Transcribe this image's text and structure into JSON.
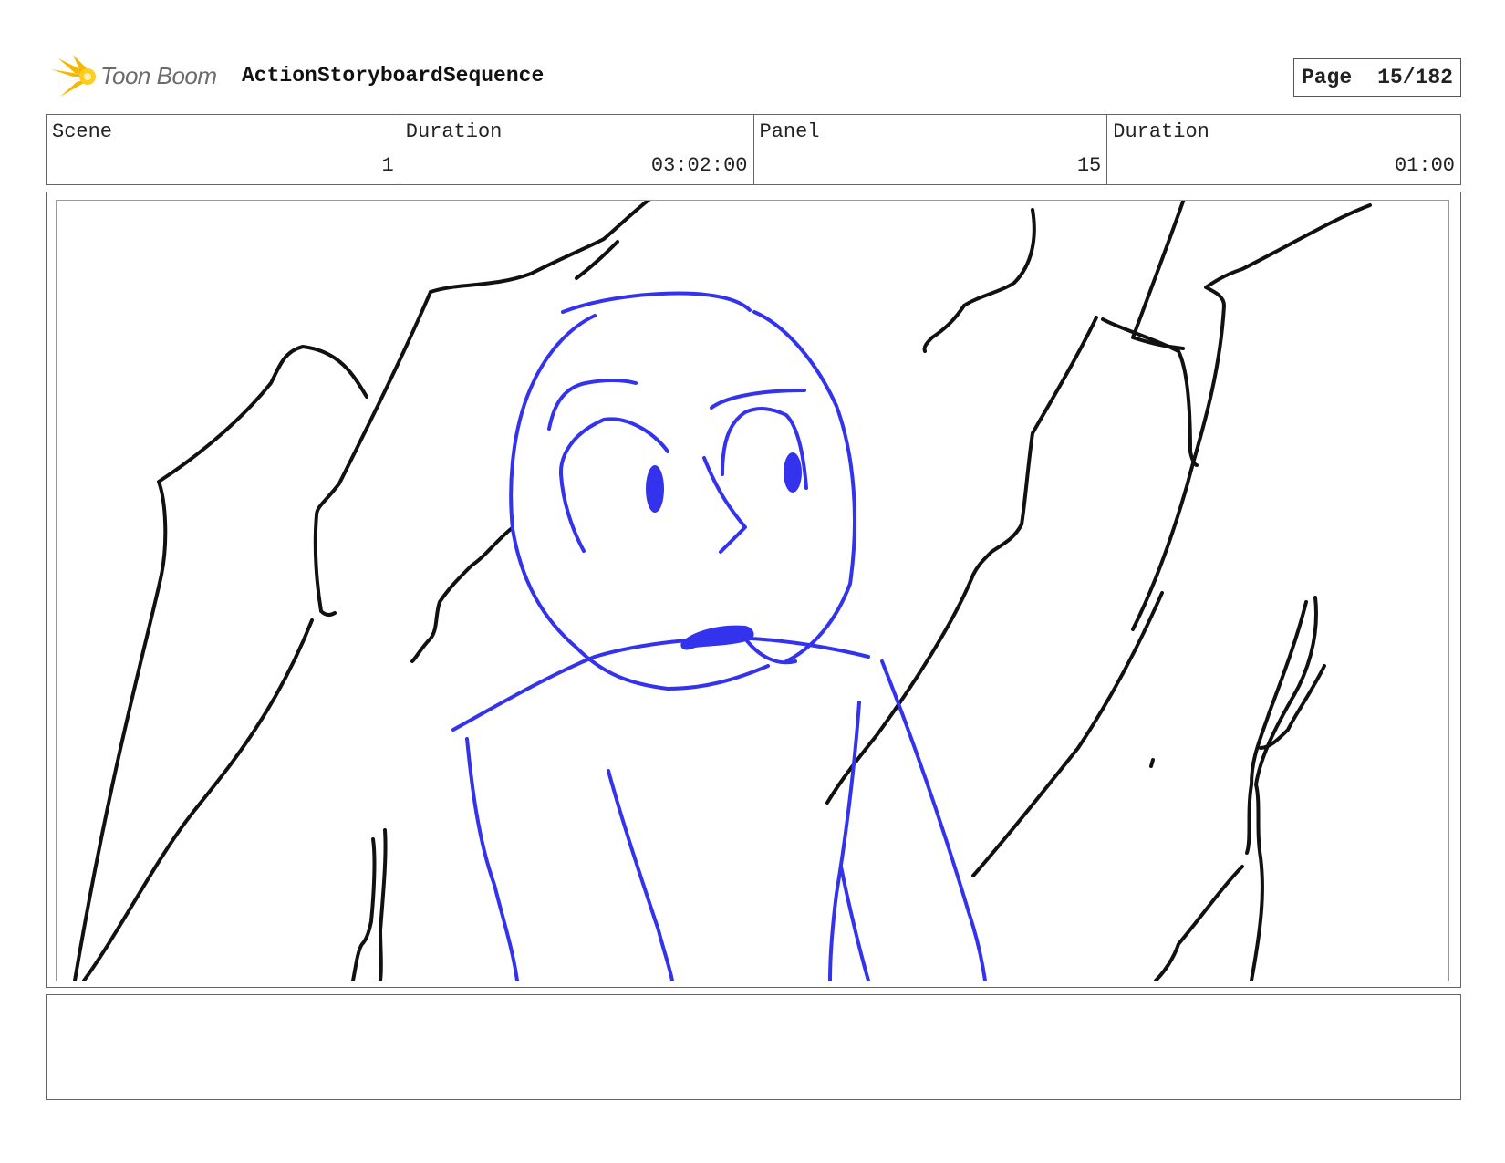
{
  "header": {
    "logo_text": "Toon Boom",
    "sequence_title": "ActionStoryboardSequence",
    "page_label": "Page",
    "page_value": "15/182"
  },
  "info": {
    "scene_label": "Scene",
    "scene_value": "1",
    "scene_duration_label": "Duration",
    "scene_duration_value": "03:02:00",
    "panel_label": "Panel",
    "panel_value": "15",
    "panel_duration_label": "Duration",
    "panel_duration_value": "01:00"
  },
  "colors": {
    "sketch_black": "#111111",
    "sketch_blue": "#3333ee",
    "logo_yellow": "#f5b800"
  },
  "icons": [
    "toon-boom-logo-icon"
  ]
}
